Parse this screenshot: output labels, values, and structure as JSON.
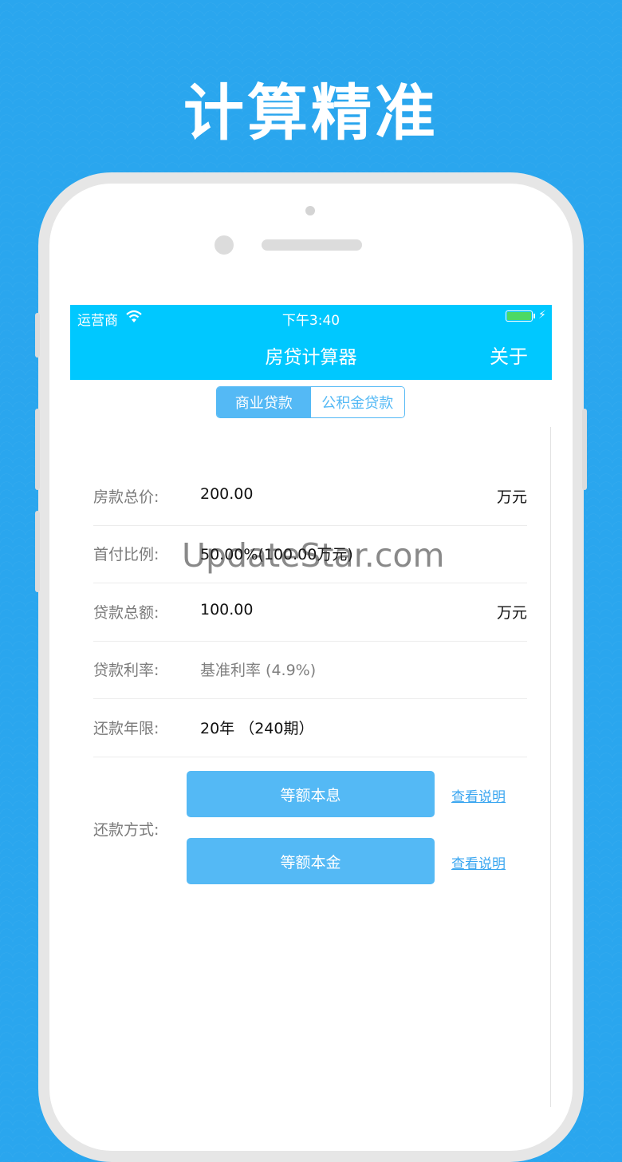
{
  "headline": "计算精准",
  "status": {
    "carrier": "运营商",
    "time": "下午3:40"
  },
  "nav": {
    "title": "房贷计算器",
    "about": "关于"
  },
  "tabs": [
    "商业贷款",
    "公积金贷款"
  ],
  "rows": [
    {
      "label": "房款总价:",
      "value": "200.00",
      "unit": "万元"
    },
    {
      "label": "首付比例:",
      "value": "50.00%(100.00万元)",
      "unit": ""
    },
    {
      "label": "贷款总额:",
      "value": "100.00",
      "unit": "万元"
    },
    {
      "label": "贷款利率:",
      "value": "基准利率 (4.9%)",
      "unit": ""
    },
    {
      "label": "还款年限:",
      "value": "20年 （240期）",
      "unit": ""
    }
  ],
  "repayment": {
    "label": "还款方式:",
    "methods": [
      "等额本息",
      "等额本金"
    ],
    "link": "查看说明"
  },
  "watermark": "UpdateStar.com",
  "colors": {
    "background": "#2aa6ee",
    "navbar": "#00c8ff",
    "accent": "#54b9f5",
    "battery": "#4cd964"
  }
}
